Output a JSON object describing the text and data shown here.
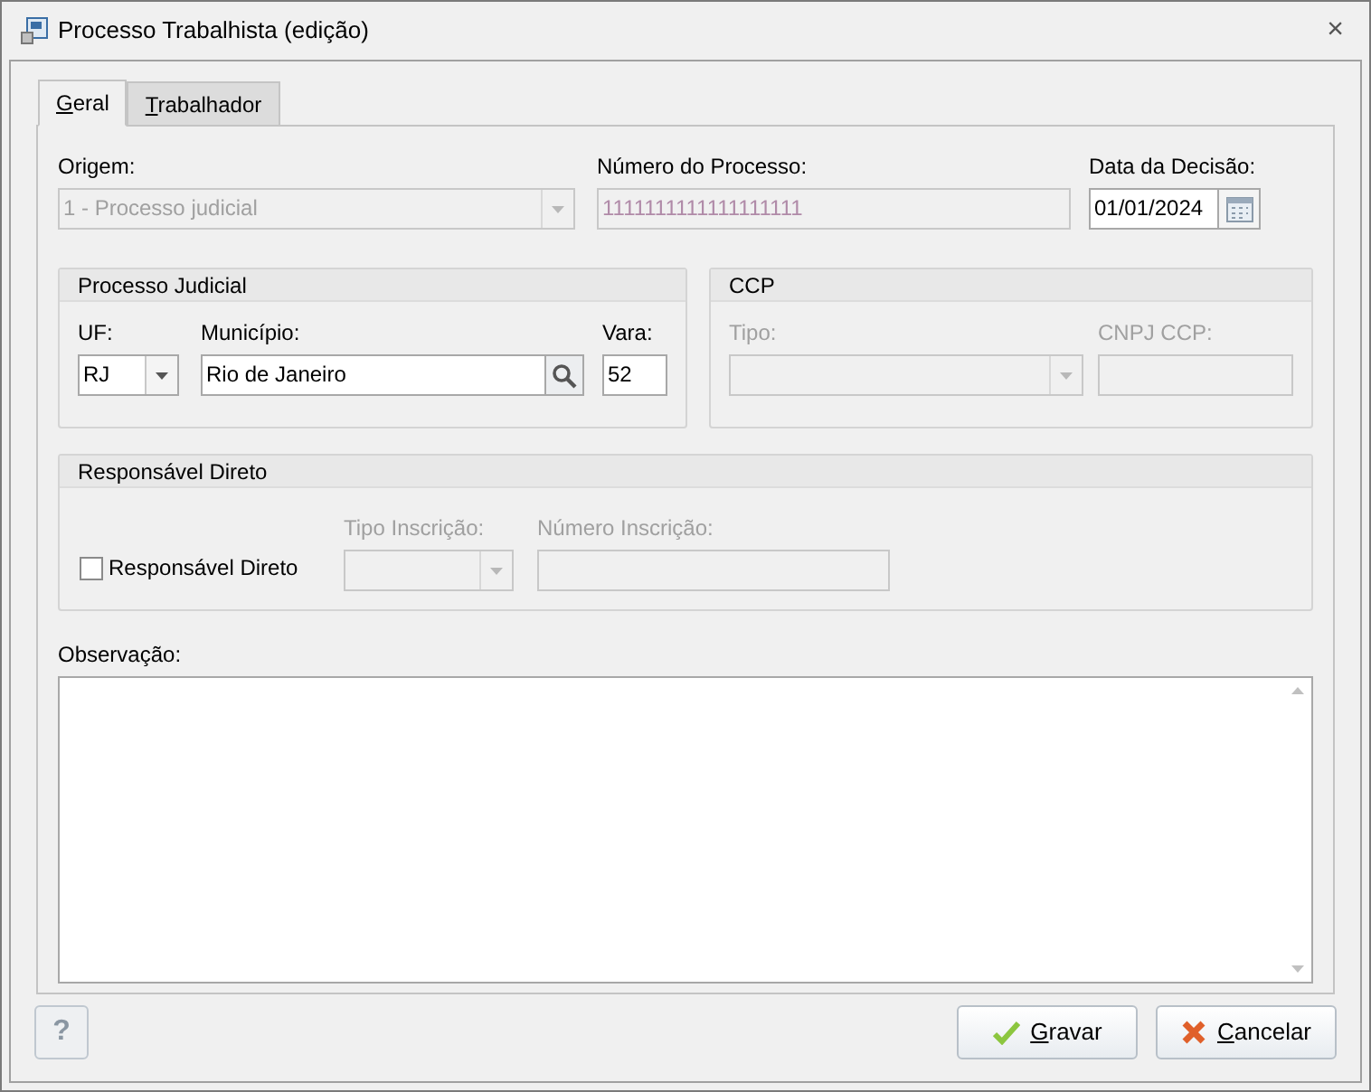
{
  "window": {
    "title": "Processo Trabalhista (edição)",
    "close": "×"
  },
  "tabs": [
    {
      "label": "Geral",
      "selected": true
    },
    {
      "label": "Trabalhador",
      "selected": false
    }
  ],
  "origem": {
    "label": "Origem:",
    "value": "1 - Processo judicial",
    "disabled": true
  },
  "numero_processo": {
    "label": "Número do Processo:",
    "value": "1111111111111111111",
    "disabled": true
  },
  "data_decisao": {
    "label": "Data da Decisão:",
    "value": "01/01/2024"
  },
  "processo_judicial": {
    "title": "Processo Judicial",
    "uf": {
      "label": "UF:",
      "value": "RJ"
    },
    "municipio": {
      "label": "Município:",
      "value": "Rio de Janeiro"
    },
    "vara": {
      "label": "Vara:",
      "value": "52"
    }
  },
  "ccp": {
    "title": "CCP",
    "disabled": true,
    "tipo": {
      "label": "Tipo:"
    },
    "cnpj": {
      "label": "CNPJ CCP:"
    }
  },
  "responsavel": {
    "title": "Responsável Direto",
    "checkbox": {
      "label": "Responsável Direto",
      "checked": false
    },
    "tipo_inscricao": {
      "label": "Tipo Inscrição:",
      "disabled": true
    },
    "numero_inscricao": {
      "label": "Número Inscrição:",
      "disabled": true
    }
  },
  "observacao": {
    "label": "Observação:"
  },
  "help": "?",
  "buttons": [
    {
      "kind": "save",
      "label": "Gravar"
    },
    {
      "kind": "cancel",
      "label": "Cancelar"
    }
  ]
}
